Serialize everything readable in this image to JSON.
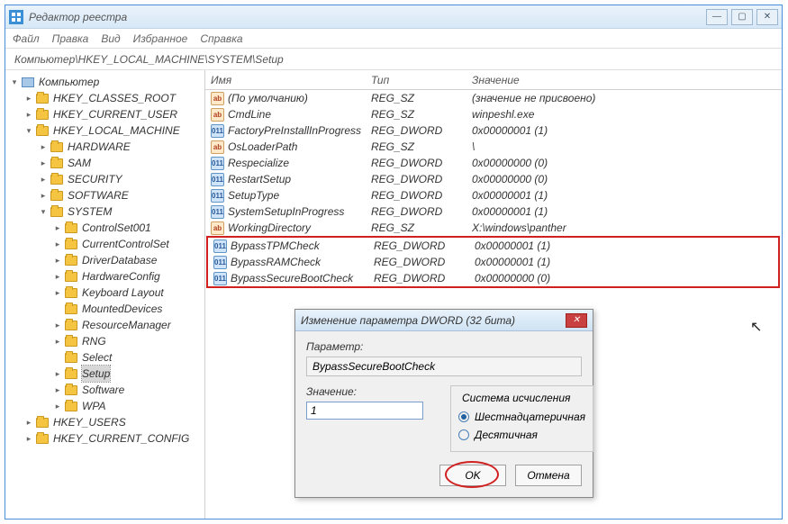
{
  "window": {
    "title": "Редактор реестра",
    "controls": {
      "min": "—",
      "max": "▢",
      "close": "✕"
    }
  },
  "menu": [
    "Файл",
    "Правка",
    "Вид",
    "Избранное",
    "Справка"
  ],
  "address": "Компьютер\\HKEY_LOCAL_MACHINE\\SYSTEM\\Setup",
  "tree": {
    "root": "Компьютер",
    "hkcr": "HKEY_CLASSES_ROOT",
    "hkcu": "HKEY_CURRENT_USER",
    "hklm": "HKEY_LOCAL_MACHINE",
    "hklm_children": {
      "hardware": "HARDWARE",
      "sam": "SAM",
      "security": "SECURITY",
      "software": "SOFTWARE",
      "system": "SYSTEM"
    },
    "system_children": {
      "cs001": "ControlSet001",
      "ccs": "CurrentControlSet",
      "driverdb": "DriverDatabase",
      "hwconfig": "HardwareConfig",
      "kbd": "Keyboard Layout",
      "md": "MountedDevices",
      "rm": "ResourceManager",
      "rng": "RNG",
      "select": "Select",
      "setup": "Setup",
      "sw": "Software",
      "wpa": "WPA"
    },
    "hku": "HKEY_USERS",
    "hkcc": "HKEY_CURRENT_CONFIG"
  },
  "list": {
    "headers": {
      "name": "Имя",
      "type": "Тип",
      "data": "Значение"
    },
    "rows": [
      {
        "icon": "sz",
        "name": "(По умолчанию)",
        "type": "REG_SZ",
        "data": "(значение не присвоено)"
      },
      {
        "icon": "sz",
        "name": "CmdLine",
        "type": "REG_SZ",
        "data": "winpeshl.exe"
      },
      {
        "icon": "dw",
        "name": "FactoryPreInstallInProgress",
        "type": "REG_DWORD",
        "data": "0x00000001 (1)"
      },
      {
        "icon": "sz",
        "name": "OsLoaderPath",
        "type": "REG_SZ",
        "data": "\\"
      },
      {
        "icon": "dw",
        "name": "Respecialize",
        "type": "REG_DWORD",
        "data": "0x00000000 (0)"
      },
      {
        "icon": "dw",
        "name": "RestartSetup",
        "type": "REG_DWORD",
        "data": "0x00000000 (0)"
      },
      {
        "icon": "dw",
        "name": "SetupType",
        "type": "REG_DWORD",
        "data": "0x00000001 (1)"
      },
      {
        "icon": "dw",
        "name": "SystemSetupInProgress",
        "type": "REG_DWORD",
        "data": "0x00000001 (1)"
      },
      {
        "icon": "sz",
        "name": "WorkingDirectory",
        "type": "REG_SZ",
        "data": "X:\\windows\\panther"
      }
    ],
    "highlighted_rows": [
      {
        "icon": "dw",
        "name": "BypassTPMCheck",
        "type": "REG_DWORD",
        "data": "0x00000001 (1)"
      },
      {
        "icon": "dw",
        "name": "BypassRAMCheck",
        "type": "REG_DWORD",
        "data": "0x00000001 (1)"
      },
      {
        "icon": "dw",
        "name": "BypassSecureBootCheck",
        "type": "REG_DWORD",
        "data": "0x00000000 (0)"
      }
    ]
  },
  "dialog": {
    "title": "Изменение параметра DWORD (32 бита)",
    "param_label": "Параметр:",
    "param_value": "BypassSecureBootCheck",
    "value_label": "Значение:",
    "value_input": "1",
    "radix_group": "Система исчисления",
    "radix_hex": "Шестнадцатеричная",
    "radix_dec": "Десятичная",
    "ok": "OK",
    "cancel": "Отмена"
  }
}
